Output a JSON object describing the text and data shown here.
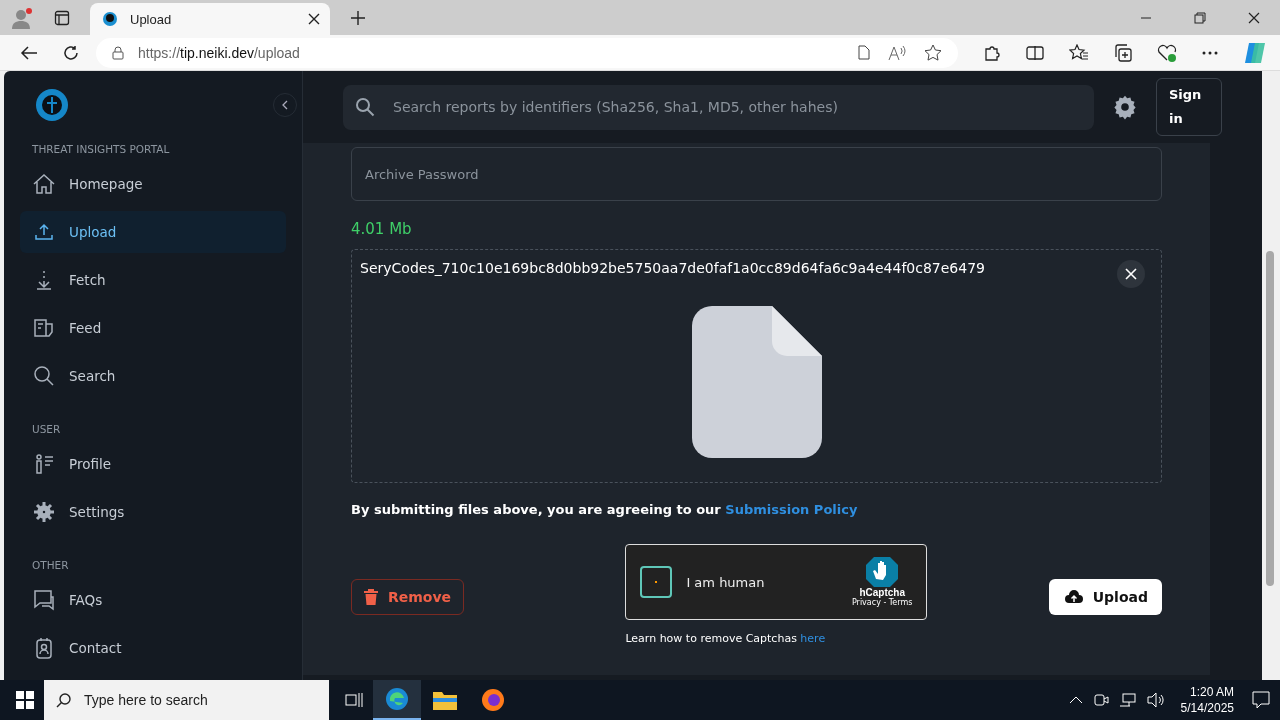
{
  "browser": {
    "tab_title": "Upload",
    "url_host": "tip.neiki.dev",
    "url_scheme": "https://",
    "url_path": "/upload"
  },
  "sidebar": {
    "sections": [
      {
        "heading": "THREAT INSIGHTS PORTAL",
        "items": [
          {
            "label": "Homepage",
            "selected": false
          },
          {
            "label": "Upload",
            "selected": true
          },
          {
            "label": "Fetch",
            "selected": false
          },
          {
            "label": "Feed",
            "selected": false
          },
          {
            "label": "Search",
            "selected": false
          }
        ]
      },
      {
        "heading": "USER",
        "items": [
          {
            "label": "Profile",
            "selected": false
          },
          {
            "label": "Settings",
            "selected": false
          }
        ]
      },
      {
        "heading": "OTHER",
        "items": [
          {
            "label": "FAQs",
            "selected": false
          },
          {
            "label": "Contact",
            "selected": false
          }
        ]
      }
    ]
  },
  "topbar": {
    "search_placeholder": "Search reports by identifiers (Sha256, Sha1, MD5, other hahes)",
    "sign_in": "Sign in"
  },
  "form": {
    "password_placeholder": "Archive Password",
    "file_size": "4.01 Mb",
    "file_name": "SeryCodes_710c10e169bc8d0bb92be5750aa7de0faf1a0cc89d64fa6c9a4e44f0c87e6479",
    "agreement": "By submitting files above, you are agreeing to our",
    "agreement_link": "Submission Policy",
    "captcha": {
      "label": "I am human",
      "checked": false,
      "brand": "hCaptcha",
      "links": "Privacy - Terms"
    },
    "captcha_note": "Learn how to remove Captchas",
    "captcha_note_link": "here",
    "remove": "Remove",
    "upload": "Upload"
  },
  "taskbar": {
    "search_placeholder": "Type here to search",
    "time": "1:20 AM",
    "date": "5/14/2025"
  }
}
